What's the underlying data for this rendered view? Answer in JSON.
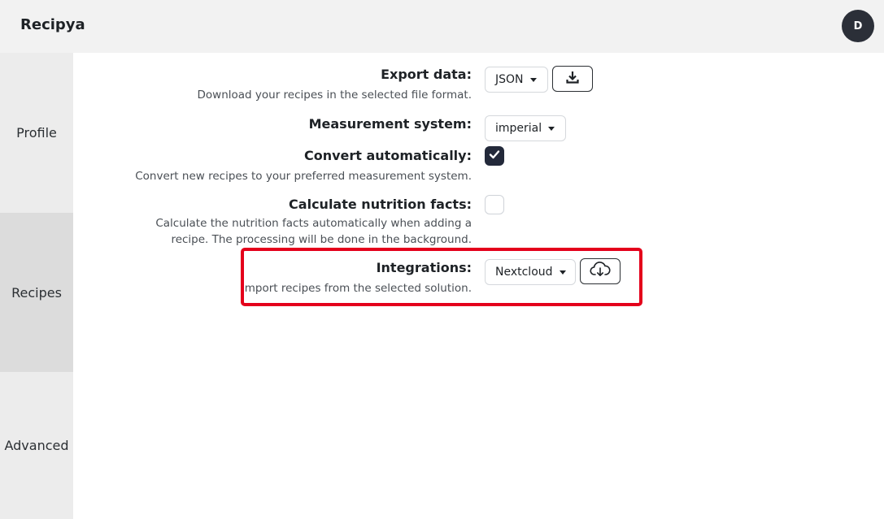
{
  "header": {
    "title": "Recipya",
    "avatar_initial": "D"
  },
  "sidebar": {
    "tabs": [
      {
        "label": "Profile"
      },
      {
        "label": "Recipes",
        "active": true
      },
      {
        "label": "Advanced"
      }
    ]
  },
  "settings": {
    "export": {
      "label": "Export data:",
      "help": "Download your recipes in the selected file format.",
      "format": "JSON",
      "download_icon": "download-icon"
    },
    "measurement": {
      "label": "Measurement system:",
      "value": "imperial"
    },
    "convert": {
      "label": "Convert automatically:",
      "help": "Convert new recipes to your preferred measurement system.",
      "checked": true
    },
    "nutrition": {
      "label": "Calculate nutrition facts:",
      "help_line1": "Calculate the nutrition facts automatically when adding a",
      "help_line2": "recipe. The processing will be done in the background.",
      "checked": false
    },
    "integrations": {
      "label": "Integrations:",
      "help": "Import recipes from the selected solution.",
      "value": "Nextcloud",
      "import_icon": "cloud-download-icon"
    }
  },
  "colors": {
    "accent_dark": "#23293a",
    "highlight": "#e4001b"
  }
}
